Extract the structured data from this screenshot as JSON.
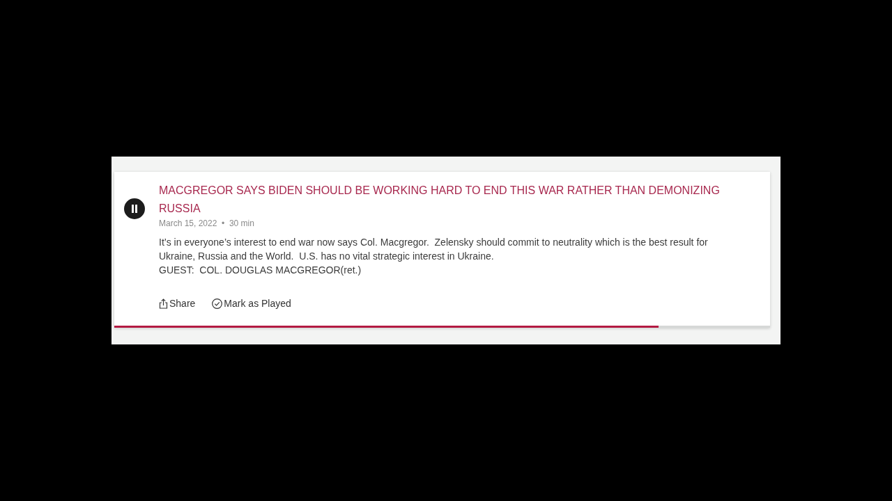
{
  "episode": {
    "playing": true,
    "title": "MACGREGOR SAYS BIDEN SHOULD BE WORKING HARD TO END THIS WAR RATHER THAN DEMONIZING RUSSIA",
    "meta": "March 15, 2022  •  30 min",
    "description_lines": [
      "It’s in everyone’s interest to end war now says Col. Macgregor.  Zelensky should commit to neutrality which is the best result for",
      "Ukraine, Russia and the World.  U.S. has no vital strategic interest in Ukraine.",
      "GUEST:  COL. DOUGLAS MACGREGOR(ret.)"
    ],
    "actions": [
      {
        "kind": "share",
        "label": "Share"
      },
      {
        "kind": "mark_played",
        "label": "Mark as Played"
      }
    ],
    "progress": {
      "level": 0.83
    }
  }
}
